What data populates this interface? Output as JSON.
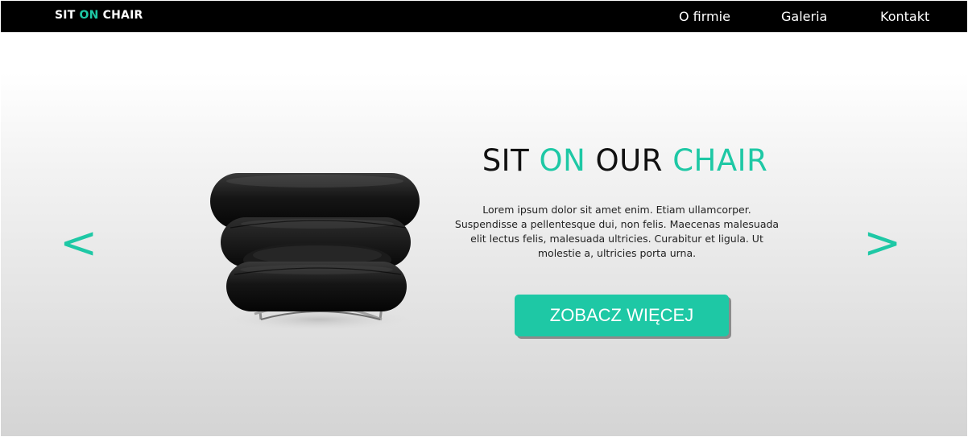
{
  "header": {
    "logo": {
      "part1": "SIT",
      "part2": "ON",
      "part3": "CHAIR"
    },
    "nav": [
      {
        "label": "O firmie"
      },
      {
        "label": "Galeria"
      },
      {
        "label": "Kontakt"
      }
    ]
  },
  "hero": {
    "prev_arrow": "<",
    "next_arrow": ">",
    "title": {
      "w1": "SIT",
      "w2": "ON",
      "w3": "OUR",
      "w4": "CHAIR"
    },
    "description": "Lorem ipsum dolor sit amet enim. Etiam ullamcorper. Suspendisse a pellentesque dui, non felis. Maecenas malesuada elit lectus felis, malesuada ultricies. Curabitur et ligula. Ut molestie a, ultricies porta urna.",
    "cta_label": "ZOBACZ WIĘCEJ"
  },
  "colors": {
    "accent": "#1ec8a5",
    "navbar_bg": "#000000",
    "text_dark": "#111111"
  }
}
